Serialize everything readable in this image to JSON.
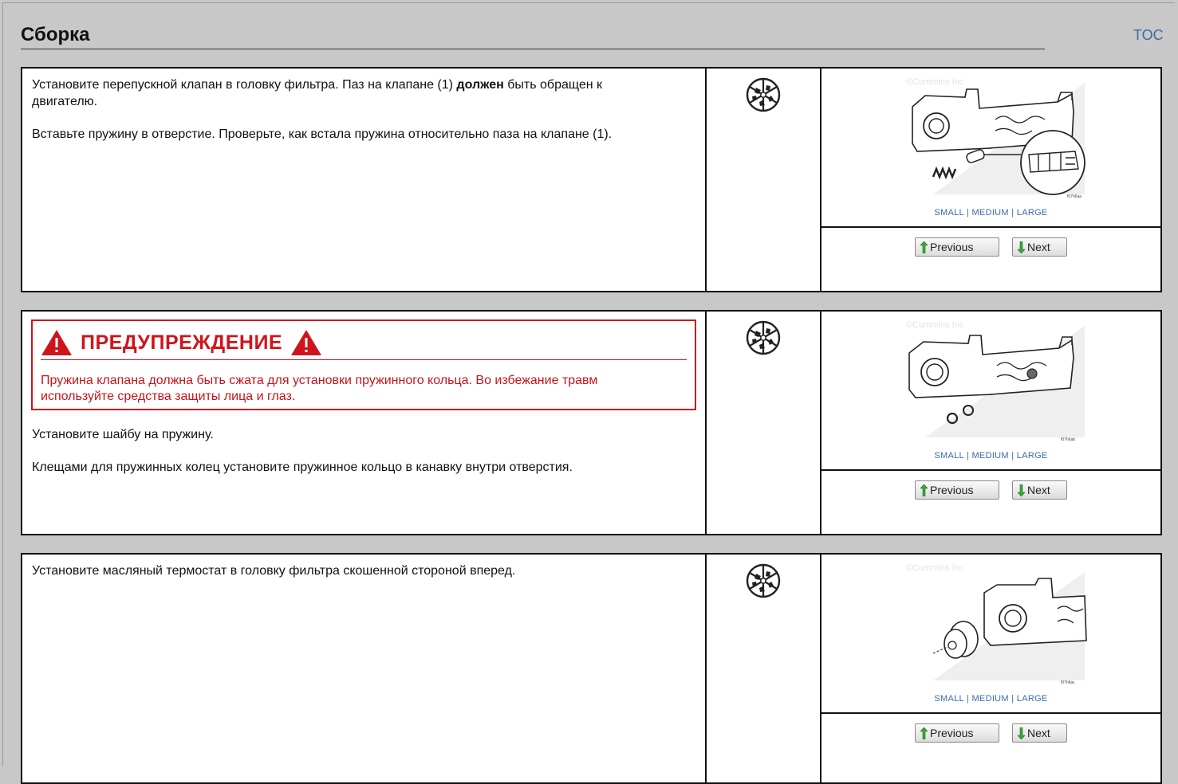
{
  "header": {
    "title": "Сборка",
    "toc_label": "TOC"
  },
  "common": {
    "size_small": "SMALL",
    "size_medium": "MEDIUM",
    "size_large": "LARGE",
    "separator": "|",
    "prev_label": "Previous",
    "next_label": "Next"
  },
  "steps": [
    {
      "paragraphs": [
        {
          "before": "Установите перепускной клапан в головку фильтра. Паз на клапане (1) ",
          "bold": "должен",
          "after": " быть обращен к двигателю."
        },
        {
          "text": "Вставьте пружину в отверстие. Проверьте, как встала пружина относительно паза на клапане (1)."
        }
      ],
      "watermark": "©Cummins Inc",
      "figure_id": "f07h6aa"
    },
    {
      "warning": {
        "title": "ПРЕДУПРЕЖДЕНИЕ",
        "text": "Пружина клапана должна быть сжата для установки пружинного кольца. Во избежание травм используйте средства защиты лица и глаз."
      },
      "paragraphs": [
        {
          "text": "Установите шайбу на пружину."
        },
        {
          "text": "Клещами для пружинных колец установите пружинное кольцо в канавку внутри отверстия."
        }
      ],
      "watermark": "©Cummins Inc",
      "figure_id": "f07h6ab"
    },
    {
      "paragraphs": [
        {
          "text": "Установите масляный термостат в головку фильтра скошенной стороной вперед."
        }
      ],
      "watermark": "©Cummins Inc",
      "figure_id": "f07h6ac"
    }
  ],
  "colors": {
    "warning": "#d0141b",
    "link": "#3a6aa8",
    "background": "#c8c8c8"
  }
}
